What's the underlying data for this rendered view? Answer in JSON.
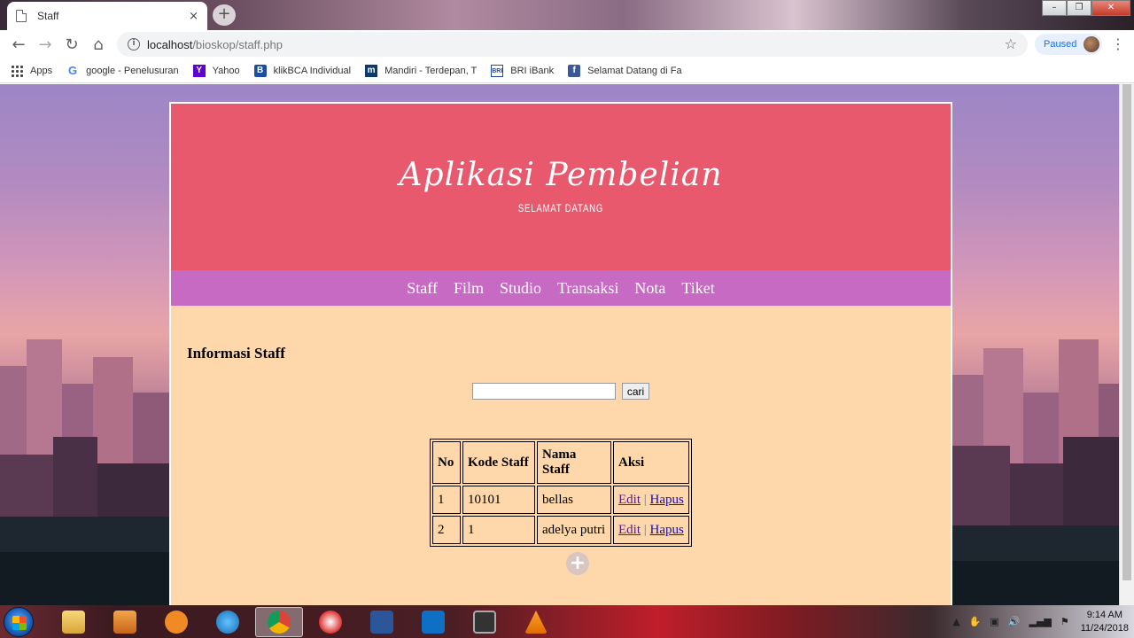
{
  "browser": {
    "tab_title": "Staff",
    "tab_close": "×",
    "new_tab": "+",
    "url_host": "localhost",
    "url_path": "/bioskop/staff.php",
    "profile_status": "Paused",
    "window_controls": [
      "–",
      "❐",
      "✕"
    ]
  },
  "bookmarks": [
    {
      "label": "Apps",
      "icon": "apps-grid-icon"
    },
    {
      "label": "google - Penelusuran",
      "icon": "google-icon"
    },
    {
      "label": "Yahoo",
      "icon": "yahoo-icon"
    },
    {
      "label": "klikBCA Individual",
      "icon": "bca-icon"
    },
    {
      "label": "Mandiri - Terdepan, T",
      "icon": "mandiri-icon"
    },
    {
      "label": "BRI iBank",
      "icon": "bri-icon"
    },
    {
      "label": "Selamat Datang di Fa",
      "icon": "facebook-icon"
    }
  ],
  "page": {
    "banner_title": "Aplikasi Pembelian",
    "banner_subtitle": "SELAMAT DATANG",
    "menu": [
      "Staff",
      "Film",
      "Studio",
      "Transaksi",
      "Nota",
      "Tiket"
    ],
    "section_title": "Informasi Staff",
    "search_value": "",
    "search_button": "cari",
    "table": {
      "headers": [
        "No",
        "Kode Staff",
        "Nama Staff",
        "Aksi"
      ],
      "rows": [
        {
          "no": "1",
          "kode": "10101",
          "nama": "bellas",
          "edit": "Edit",
          "sep": "|",
          "hapus": "Hapus"
        },
        {
          "no": "2",
          "kode": "1",
          "nama": "adelya putri",
          "edit": "Edit",
          "sep": "|",
          "hapus": "Hapus"
        }
      ]
    },
    "colors": {
      "banner": "#e9596e",
      "menu": "#c76ac4",
      "content": "#fed7aa"
    }
  },
  "taskbar": {
    "time": "9:14 AM",
    "date": "11/24/2018"
  }
}
